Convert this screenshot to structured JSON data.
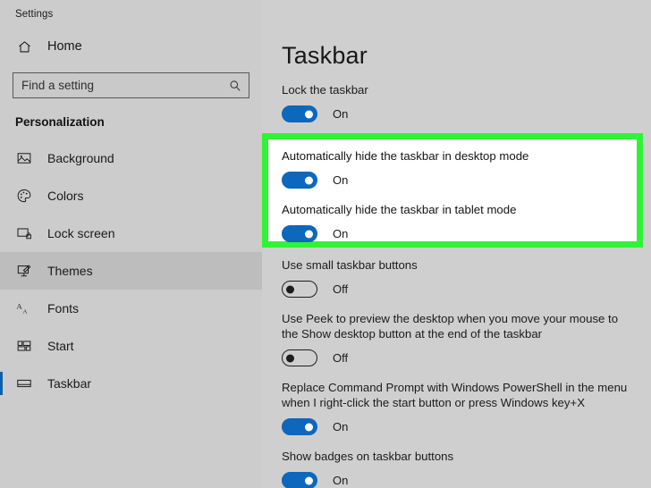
{
  "sidebar": {
    "app_title": "Settings",
    "home": {
      "label": "Home",
      "icon": "home-icon"
    },
    "search": {
      "placeholder": "Find a setting",
      "value": "",
      "icon": "search-icon"
    },
    "section_header": "Personalization",
    "items": [
      {
        "label": "Background",
        "icon": "image-icon",
        "selected": false,
        "current": false
      },
      {
        "label": "Colors",
        "icon": "palette-icon",
        "selected": false,
        "current": false
      },
      {
        "label": "Lock screen",
        "icon": "lock-screen-icon",
        "selected": false,
        "current": false
      },
      {
        "label": "Themes",
        "icon": "themes-icon",
        "selected": true,
        "current": false
      },
      {
        "label": "Fonts",
        "icon": "fonts-icon",
        "selected": false,
        "current": false
      },
      {
        "label": "Start",
        "icon": "start-icon",
        "selected": false,
        "current": false
      },
      {
        "label": "Taskbar",
        "icon": "taskbar-icon",
        "selected": false,
        "current": true
      }
    ]
  },
  "main": {
    "title": "Taskbar",
    "settings": {
      "lock_taskbar": {
        "text": "Lock the taskbar",
        "state": "On"
      },
      "autohide_desktop": {
        "text": "Automatically hide the taskbar in desktop mode",
        "state": "On"
      },
      "autohide_tablet": {
        "text": "Automatically hide the taskbar in tablet mode",
        "state": "On"
      },
      "small_buttons": {
        "text": "Use small taskbar buttons",
        "state": "Off"
      },
      "peek": {
        "text": "Use Peek to preview the desktop when you move your mouse to the Show desktop button at the end of the taskbar",
        "state": "Off"
      },
      "powershell": {
        "text": "Replace Command Prompt with Windows PowerShell in the menu when I right-click the start button or press Windows key+X",
        "state": "On"
      },
      "badges": {
        "text": "Show badges on taskbar buttons",
        "state": "On"
      }
    }
  },
  "annotation": {
    "highlight_color": "#2ff435"
  },
  "colors": {
    "accent_blue": "#0d67bd",
    "sidebar_bg": "#cccccc",
    "content_bg": "#cfcfcf",
    "selected_bg": "#bdbdbd"
  }
}
